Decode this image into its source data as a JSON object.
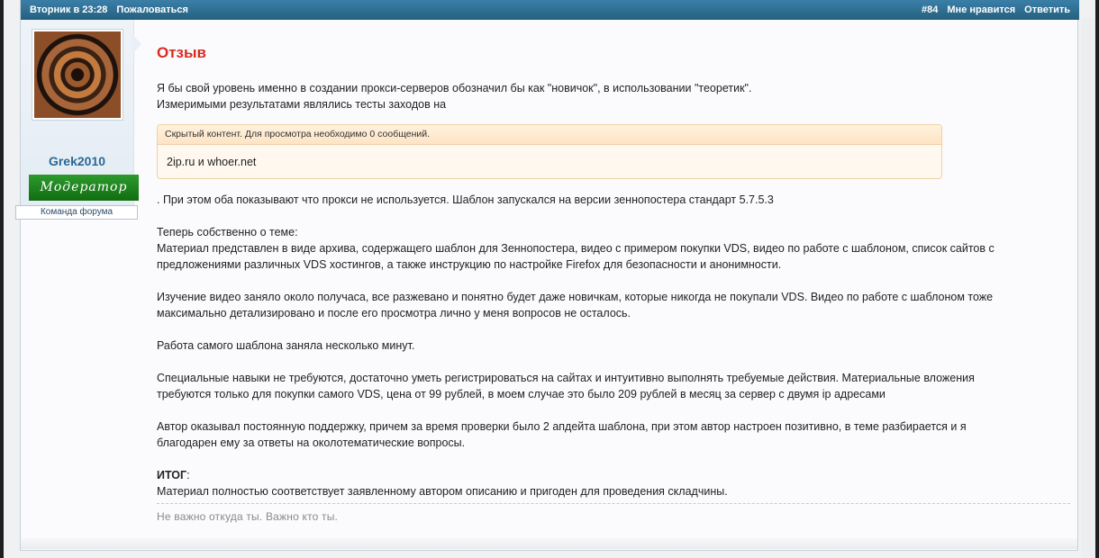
{
  "topbar": {
    "date": "Вторник в 23:28",
    "report": "Пожаловаться",
    "post_number": "#84",
    "like": "Мне нравится",
    "reply": "Ответить"
  },
  "user": {
    "name": "Grek2010",
    "rank_badge": "Модератор",
    "team": "Команда форума"
  },
  "post": {
    "title": "Отзыв",
    "intro_line1": "Я бы свой уровень именно в создании прокси-серверов обозначил бы как \"новичок\", в использовании \"теоретик\".",
    "intro_line2": "Измеримыми результатами являлись тесты заходов на",
    "hidden_header": "Скрытый контент. Для просмотра необходимо 0 сообщений.",
    "hidden_text": "2ip.ru и whoer.net",
    "after_hidden": ". При этом оба показывают что прокси не используется. Шаблон запускался на версии зеннопостера стандарт 5.7.5.3",
    "p1_line1": "Теперь собственно о теме:",
    "p1_line2": "Материал представлен в виде архива, содержащего шаблон для Зеннопостера, видео с примером покупки VDS, видео по работе с шаблоном, список сайтов с",
    "p1_line3": "предложениями различных VDS хостингов, а также инструкцию по настройке Firefox для безопасности и анонимности.",
    "p2_line1": "Изучение видео заняло около получаса, все разжевано и понятно будет даже новичкам, которые никогда не покупали VDS. Видео по работе с шаблоном тоже",
    "p2_line2": "максимально детализировано и после его просмотра лично у меня вопросов не осталось.",
    "p3": "Работа самого шаблона заняла несколько минут.",
    "p4_line1": "Специальные навыки не требуются, достаточно уметь регистрироваться на сайтах и интуитивно выполнять требуемые действия. Материальные вложения",
    "p4_line2": "требуются только для покупки самого VDS, цена от 99 рублей, в моем случае это было 209 рублей в месяц за сервер с двумя ip адресами",
    "p5_line1": "Автор оказывал постоянную поддержку, причем за время проверки было 2 апдейта шаблона, при этом автор настроен позитивно, в теме разбирается и я",
    "p5_line2": "благодарен ему за ответы на околотематические вопросы.",
    "summary_label": "ИТОГ",
    "summary_colon": ":",
    "summary_text": "Материал полностью соответствует заявленному автором описанию и пригоден для проведения складчины.",
    "signature": "Не важно откуда ты. Важно кто ты."
  },
  "colors": {
    "topbar": "#2f7299",
    "title": "#d92a1d",
    "username": "#2a6894",
    "moderator_badge": "#1a7f1a",
    "hidden_border": "#f0cfa4"
  }
}
